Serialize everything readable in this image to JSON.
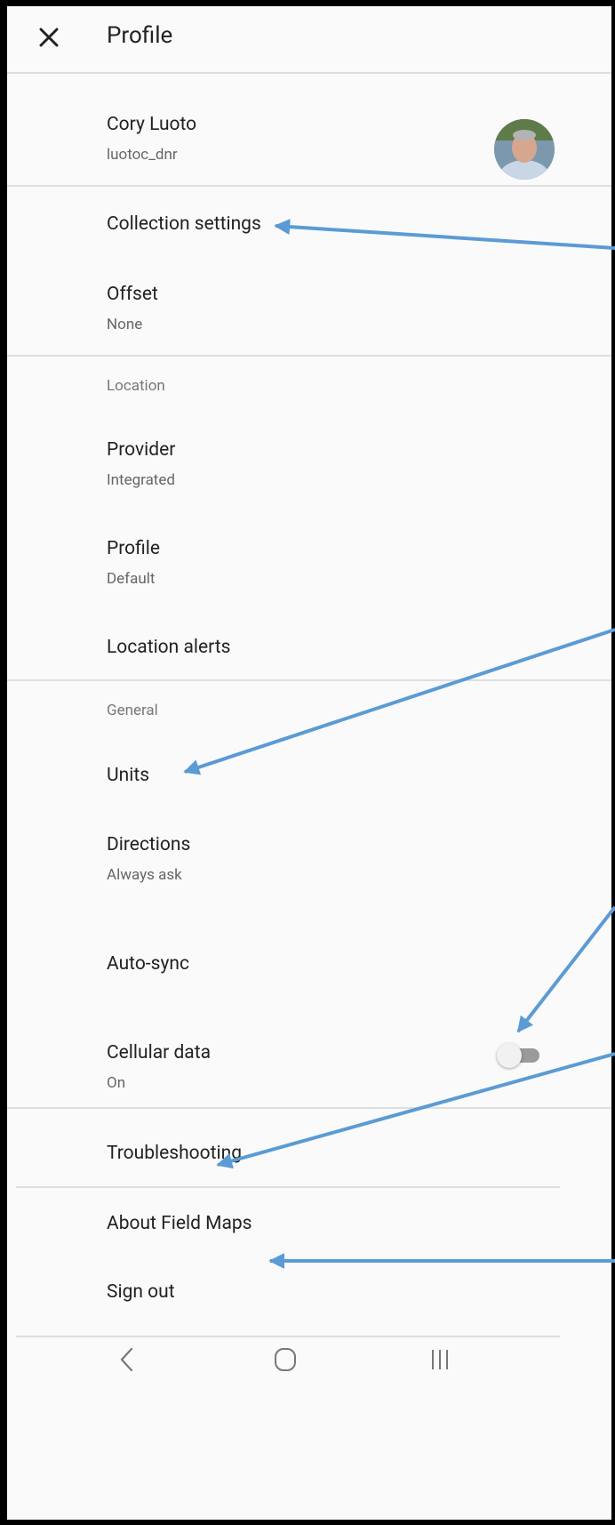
{
  "header": {
    "title": "Profile",
    "close_icon": "close-icon"
  },
  "user": {
    "name": "Cory Luoto",
    "username": "luotoc_dnr",
    "avatar_icon": "avatar-photo"
  },
  "collection": {
    "settings_label": "Collection settings",
    "offset_label": "Offset",
    "offset_value": "None"
  },
  "location": {
    "section_label": "Location",
    "provider_label": "Provider",
    "provider_value": "Integrated",
    "profile_label": "Profile",
    "profile_value": "Default",
    "alerts_label": "Location alerts"
  },
  "general": {
    "section_label": "General",
    "units_label": "Units",
    "directions_label": "Directions",
    "directions_value": "Always ask",
    "autosync_label": "Auto-sync",
    "autosync_on": false,
    "cellular_label": "Cellular data",
    "cellular_value": "On"
  },
  "footer_menu": {
    "troubleshooting_label": "Troubleshooting",
    "about_label": "About Field Maps",
    "signout_label": "Sign out"
  },
  "navbar": {
    "back_icon": "back-icon",
    "home_icon": "home-icon",
    "recents_icon": "recents-icon"
  },
  "colors": {
    "arrow": "#5b9bd5",
    "divider": "#dedede",
    "background": "#fafafa"
  }
}
